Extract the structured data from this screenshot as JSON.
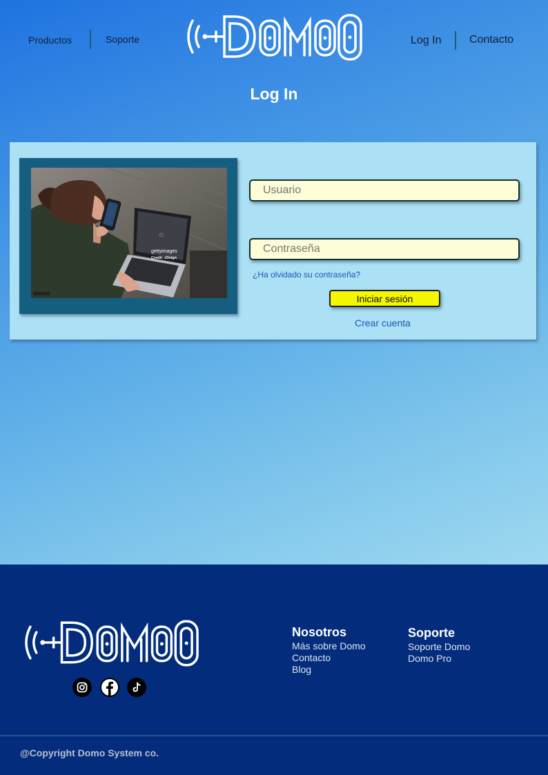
{
  "header": {
    "nav_left": [
      "Productos",
      "Soporte"
    ],
    "nav_right": [
      "Log In",
      "Contacto"
    ],
    "logo_text": "Domo"
  },
  "page": {
    "title": "Log In"
  },
  "form": {
    "username_placeholder": "Usuario",
    "password_placeholder": "Contraseña",
    "forgot_label": "¿Ha olvidado su contraseña?",
    "submit_label": "Iniciar sesión",
    "create_label": "Crear cuenta"
  },
  "photo": {
    "watermark_brand": "gettyimages",
    "watermark_credit": "Credit: d3sign"
  },
  "footer": {
    "logo_text": "Domo",
    "social_icons": [
      "instagram-icon",
      "facebook-icon",
      "tiktok-icon"
    ],
    "columns": [
      {
        "title": "Nosotros",
        "links": [
          "Más sobre Domo",
          "Contacto",
          "Blog"
        ]
      },
      {
        "title": "Soporte",
        "links": [
          "Soporte Domo",
          "Domo Pro"
        ]
      }
    ],
    "copyright": "@Copyright Domo System co."
  },
  "colors": {
    "hero_top": "#1f73e0",
    "hero_bottom": "#9ed8f0",
    "card_bg": "#ace0f4",
    "input_bg": "#fdfdd8",
    "button_bg": "#f4f700",
    "footer_bg": "#032d7c",
    "link": "#1d55b8"
  }
}
